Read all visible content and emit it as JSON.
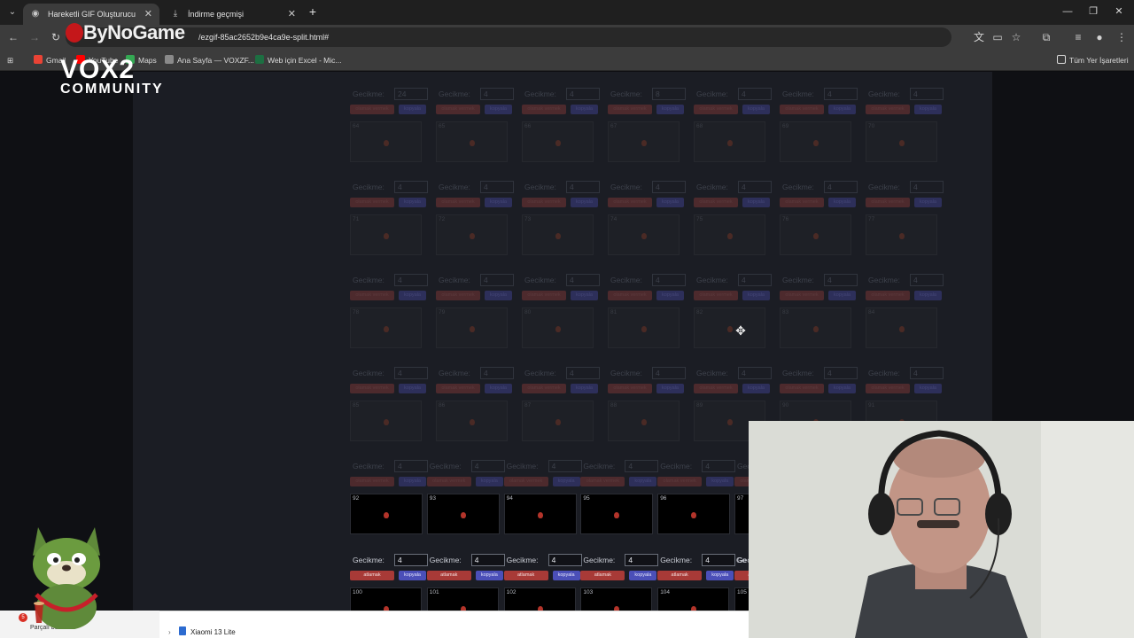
{
  "browser": {
    "tabs": [
      {
        "title": "Hareketli GIF Oluşturucu",
        "icon": "site-icon",
        "active": true
      },
      {
        "title": "İndirme geçmişi",
        "icon": "download-icon",
        "active": false
      }
    ],
    "new_tab_glyph": "+",
    "close_glyph": "✕",
    "url": "ezgif.com/ezgif-85ac2652b9e4ca9e-split.html#",
    "url_fragment": "/ezgif-85ac2652b9e4ca9e-split.html#"
  },
  "bookmarks": {
    "items": [
      {
        "label": "Gmail",
        "color": "#ea4335"
      },
      {
        "label": "YouTube",
        "color": "#ff0000"
      },
      {
        "label": "Maps",
        "color": "#34a853"
      },
      {
        "label": "Ana Sayfa — VOXZF...",
        "color": "#8a8a8a"
      },
      {
        "label": "Web için Excel - Mic...",
        "color": "#1d6f42"
      }
    ],
    "all_bookmarks": "Tüm Yer İşaretleri"
  },
  "frames": {
    "delay_label": "Gecikme:",
    "skip_label_dim": "olamak vermek",
    "skip_label": "atlamak",
    "copy_label": "kopyala",
    "rows": [
      {
        "style": "dim",
        "cells": [
          {
            "n": "64",
            "d": "24"
          },
          {
            "n": "65",
            "d": "4"
          },
          {
            "n": "66",
            "d": "4"
          },
          {
            "n": "67",
            "d": "8"
          },
          {
            "n": "68",
            "d": "4"
          },
          {
            "n": "69",
            "d": "4"
          },
          {
            "n": "70",
            "d": "4"
          }
        ]
      },
      {
        "style": "dim",
        "cells": [
          {
            "n": "71",
            "d": "4"
          },
          {
            "n": "72",
            "d": "4"
          },
          {
            "n": "73",
            "d": "4"
          },
          {
            "n": "74",
            "d": "4"
          },
          {
            "n": "75",
            "d": "4"
          },
          {
            "n": "76",
            "d": "4"
          },
          {
            "n": "77",
            "d": "4"
          }
        ]
      },
      {
        "style": "dim",
        "cells": [
          {
            "n": "78",
            "d": "4"
          },
          {
            "n": "79",
            "d": "4"
          },
          {
            "n": "80",
            "d": "4"
          },
          {
            "n": "81",
            "d": "4"
          },
          {
            "n": "82",
            "d": "4"
          },
          {
            "n": "83",
            "d": "4"
          },
          {
            "n": "84",
            "d": "4"
          }
        ]
      },
      {
        "style": "dim",
        "cells": [
          {
            "n": "85",
            "d": "4"
          },
          {
            "n": "86",
            "d": "4"
          },
          {
            "n": "87",
            "d": "4"
          },
          {
            "n": "88",
            "d": "4"
          },
          {
            "n": "89",
            "d": "4"
          },
          {
            "n": "90",
            "d": "4"
          },
          {
            "n": "91",
            "d": "4"
          }
        ]
      },
      {
        "style": "mixed",
        "cells": [
          {
            "n": "92",
            "d": "4"
          },
          {
            "n": "93",
            "d": "4"
          },
          {
            "n": "94",
            "d": "4"
          },
          {
            "n": "95",
            "d": "4"
          },
          {
            "n": "96",
            "d": "4"
          },
          {
            "n": "97",
            "d": "4"
          }
        ]
      },
      {
        "style": "lit",
        "cells": [
          {
            "n": "100",
            "d": "4"
          },
          {
            "n": "101",
            "d": "4"
          },
          {
            "n": "102",
            "d": "4"
          },
          {
            "n": "103",
            "d": "4"
          },
          {
            "n": "104",
            "d": "4"
          },
          {
            "n": "105",
            "d": ""
          }
        ]
      }
    ],
    "partial_label": "Ge"
  },
  "overlay": {
    "brand_top": "ByNoGame",
    "brand_main": "VOX2",
    "brand_sub": "COMMUNITY"
  },
  "taskbar": {
    "notification_count": "5",
    "cloud_label": "Parçalı bulutlu",
    "explorer_item": "Xiaomi 13 Lite"
  }
}
